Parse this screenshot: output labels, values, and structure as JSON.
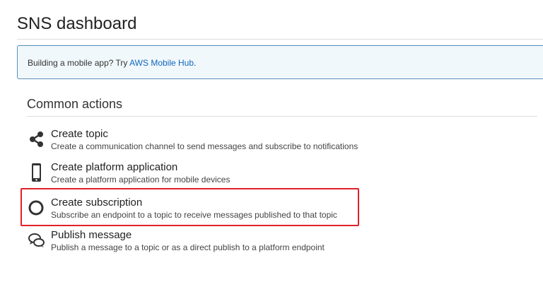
{
  "page": {
    "title": "SNS dashboard"
  },
  "banner": {
    "text": "Building a mobile app? Try ",
    "link": "AWS Mobile Hub",
    "suffix": "."
  },
  "section": {
    "title": "Common actions"
  },
  "actions": [
    {
      "icon": "share-icon",
      "label": "Create topic",
      "description": "Create a communication channel to send messages and subscribe to notifications"
    },
    {
      "icon": "mobile-device-icon",
      "label": "Create platform application",
      "description": "Create a platform application for mobile devices"
    },
    {
      "icon": "circle-icon",
      "label": "Create subscription",
      "description": "Subscribe an endpoint to a topic to receive messages published to that topic"
    },
    {
      "icon": "chat-bubbles-icon",
      "label": "Publish message",
      "description": "Publish a message to a topic or as a direct publish to a platform endpoint"
    }
  ],
  "colors": {
    "highlight": "#e0202a",
    "link": "#1166bb",
    "banner_border": "#5a8fb7",
    "banner_background": "#f1f8fc"
  }
}
